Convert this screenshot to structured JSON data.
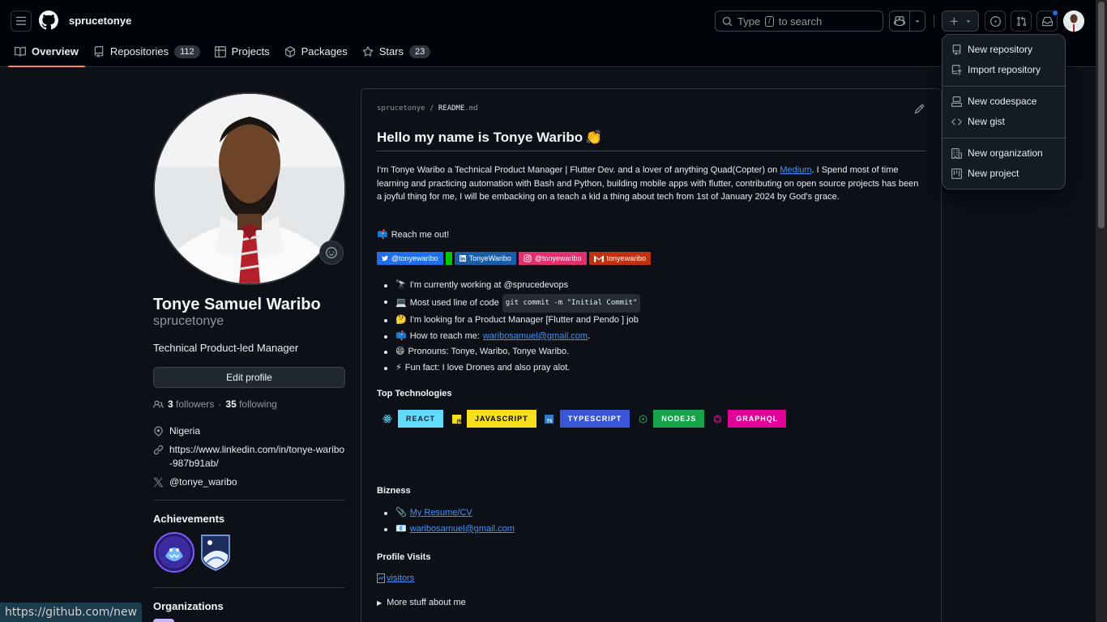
{
  "header": {
    "username": "sprucetonye",
    "search_prefix": "Type",
    "search_key": "/",
    "search_suffix": "to search"
  },
  "tabs": [
    {
      "label": "Overview",
      "count": ""
    },
    {
      "label": "Repositories",
      "count": "112"
    },
    {
      "label": "Projects",
      "count": ""
    },
    {
      "label": "Packages",
      "count": ""
    },
    {
      "label": "Stars",
      "count": "23"
    }
  ],
  "profile": {
    "name": "Tonye Samuel Waribo",
    "login": "sprucetonye",
    "bio": "Technical Product-led Manager",
    "edit_label": "Edit profile",
    "followers_count": "3",
    "followers_label": "followers",
    "following_count": "35",
    "following_label": "following",
    "location": "Nigeria",
    "website": "https://www.linkedin.com/in/tonye-waribo-987b91ab/",
    "twitter": "@tonye_waribo",
    "achievements_title": "Achievements",
    "organizations_title": "Organizations"
  },
  "readme": {
    "path_user": "sprucetonye",
    "path_sep": "/",
    "path_file": "README",
    "path_ext": ".md",
    "title": "Hello my name is Tonye Waribo",
    "title_emoji": "👏",
    "intro_1": "I'm Tonye Waribo a Technical Product Manager | Flutter Dev. and a lover of anything Quad(Copter) on ",
    "intro_link": "Medium",
    "intro_2": ". I Spend most of time learning and practicing automation with Bash and Python, building mobile apps with flutter, contributing on open source projects has been a joyful thing for me, I will be embacking on a teach a kid a thing about tech from 1st of January 2024 by God's grace.",
    "reach_emoji": "📫",
    "reach": "Reach me out!",
    "badges": [
      {
        "text": "@tonyewaribo",
        "color": "#1f6feb"
      },
      {
        "text": "",
        "color": "#00c800"
      },
      {
        "text": "TonyeWaribo",
        "color": "#1a5ea8"
      },
      {
        "text": "@tonyewaribo",
        "color": "#e1306c"
      },
      {
        "text": "tonyewaribo",
        "color": "#c0310f"
      }
    ],
    "bullets": [
      {
        "emoji": "🔭",
        "text": "I'm currently working at @sprucedevops",
        "code": "",
        "link": "",
        "tail": ""
      },
      {
        "emoji": "💻",
        "text": "Most used line of code",
        "code": "git commit -m \"Initial Commit\"",
        "link": "",
        "tail": ""
      },
      {
        "emoji": "🤔",
        "text": "I'm looking for a Product Manager [Flutter and Pendo ] job",
        "code": "",
        "link": "",
        "tail": ""
      },
      {
        "emoji": "📫",
        "text": "How to reach me:",
        "code": "",
        "link": "waribosamuel@gmail.com",
        "tail": "."
      },
      {
        "emoji": "😄",
        "text": "Pronouns: Tonye, Waribo, Tonye Waribo.",
        "code": "",
        "link": "",
        "tail": ""
      },
      {
        "emoji": "⚡",
        "text": "Fun fact: I love Drones and also pray alot.",
        "code": "",
        "link": "",
        "tail": ""
      }
    ],
    "tech_title": "Top Technologies",
    "techs": [
      {
        "name": "REACT",
        "bg": "#61dafb",
        "fg": "#20232a",
        "icon": "react-icon",
        "iconcolor": "#61dafb"
      },
      {
        "name": "JAVASCRIPT",
        "bg": "#f7df1e",
        "fg": "#000000",
        "icon": "javascript-icon",
        "iconcolor": "#f7df1e"
      },
      {
        "name": "TYPESCRIPT",
        "bg": "#3178c6",
        "fg": "#ffffff",
        "icon": "typescript-icon",
        "iconcolor": "#3178c6"
      },
      {
        "name": "NODEJS",
        "bg": "#16a34a",
        "fg": "#ffffff",
        "icon": "nodejs-icon",
        "iconcolor": "#16a34a"
      },
      {
        "name": "GRAPHQL",
        "bg": "#e10098",
        "fg": "#ffffff",
        "icon": "graphql-icon",
        "iconcolor": "#e10098"
      }
    ],
    "bizness_title": "Bizness",
    "bizness": [
      {
        "emoji": "📎",
        "link": "My Resume/CV"
      },
      {
        "emoji": "📧",
        "link": "waribosamuel@gmail.com"
      }
    ],
    "visits_title": "Profile Visits",
    "visitors_alt": "visitors",
    "more_stuff": "More stuff about me"
  },
  "dropdown": {
    "items": [
      {
        "label": "New repository",
        "icon": "repo-icon"
      },
      {
        "label": "Import repository",
        "icon": "repo-push-icon"
      },
      {
        "label": "New codespace",
        "icon": "codespaces-icon"
      },
      {
        "label": "New gist",
        "icon": "code-icon"
      },
      {
        "label": "New organization",
        "icon": "organization-icon"
      },
      {
        "label": "New project",
        "icon": "project-icon"
      }
    ]
  },
  "status_url": "https://github.com/new"
}
